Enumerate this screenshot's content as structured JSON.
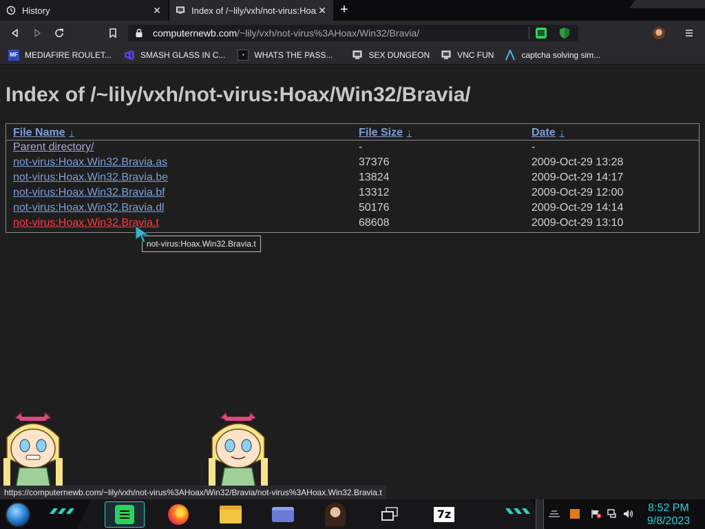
{
  "tabs": [
    {
      "title": "History",
      "icon": "history-icon"
    },
    {
      "title": "Index of /~lily/vxh/not-virus:Hoax/",
      "icon": "page-favicon-icon"
    }
  ],
  "url": {
    "host": "computernewb.com",
    "path": "/~lily/vxh/not-virus%3AHoax/Win32/Bravia/"
  },
  "bookmarks": [
    {
      "label": "MEDIAFIRE ROULET...",
      "icon": "mediafire-icon"
    },
    {
      "label": "SMASH GLASS IN C...",
      "icon": "visual-studio-icon"
    },
    {
      "label": "WHATS THE PASS...",
      "icon": "dark-square-icon"
    },
    {
      "label": "SEX DUNGEON",
      "icon": "monitor-icon"
    },
    {
      "label": "VNC FUN",
      "icon": "monitor-icon"
    },
    {
      "label": "captcha solving sim...",
      "icon": "arrow-a-icon"
    }
  ],
  "page": {
    "title": "Index of /~lily/vxh/not-virus:Hoax/Win32/Bravia/",
    "columns": {
      "name": "File Name",
      "size": "File Size",
      "date": "Date",
      "sort_glyph": "↓"
    },
    "rows": [
      {
        "name": "Parent directory/",
        "size": "-",
        "date": "-",
        "state": "visited"
      },
      {
        "name": "not-virus:Hoax.Win32.Bravia.as",
        "size": "37376",
        "date": "2009-Oct-29 13:28",
        "state": "link"
      },
      {
        "name": "not-virus:Hoax.Win32.Bravia.be",
        "size": "13824",
        "date": "2009-Oct-29 14:17",
        "state": "link"
      },
      {
        "name": "not-virus:Hoax.Win32.Bravia.bf",
        "size": "13312",
        "date": "2009-Oct-29 12:00",
        "state": "link"
      },
      {
        "name": "not-virus:Hoax.Win32.Bravia.dl",
        "size": "50176",
        "date": "2009-Oct-29 14:14",
        "state": "link"
      },
      {
        "name": "not-virus:Hoax.Win32.Bravia.t",
        "size": "68608",
        "date": "2009-Oct-29 13:10",
        "state": "hover"
      }
    ],
    "tooltip": "not-virus:Hoax.Win32.Bravia.t"
  },
  "status_url": "https://computernewb.com/~lily/vxh/not-virus%3AHoax/Win32/Bravia/not-virus%3AHoax.Win32.Bravia.t",
  "taskbar": {
    "apps": [
      "spotify-icon",
      "firefox-icon",
      "file-explorer-icon",
      "card-app-icon",
      "portrait-app-icon",
      "task-view-icon",
      "7zip-icon"
    ],
    "clock_time": "8:52 PM",
    "clock_date": "9/8/2023"
  },
  "colors": {
    "link": "#7e9fd8",
    "visited": "#b4a0e0",
    "hover": "#ff3b3b",
    "clock": "#2bd1e0"
  }
}
